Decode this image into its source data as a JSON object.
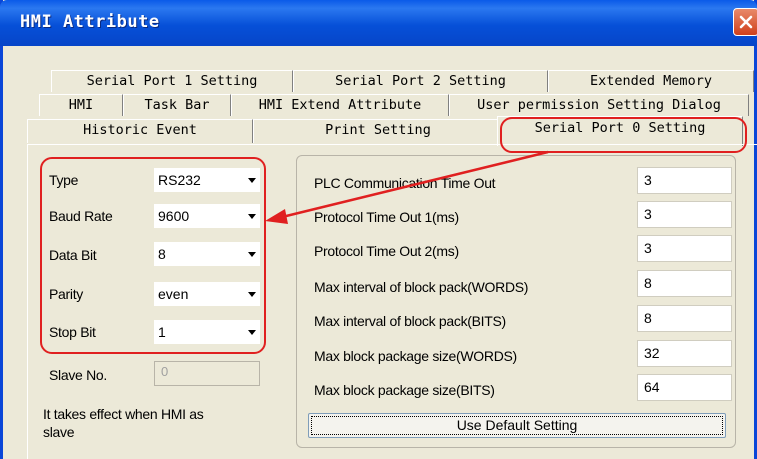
{
  "window": {
    "title": "HMI Attribute"
  },
  "tabs": {
    "row1": [
      "Serial Port 1 Setting",
      "Serial Port 2 Setting",
      "Extended Memory"
    ],
    "row2": [
      "HMI",
      "Task Bar",
      "HMI Extend Attribute",
      "User permission Setting Dialog"
    ],
    "row3": [
      "Historic Event",
      "Print Setting",
      "Serial Port 0 Setting"
    ],
    "active": "Serial Port 0 Setting"
  },
  "serial": {
    "type": {
      "label": "Type",
      "value": "RS232"
    },
    "baud_rate": {
      "label": "Baud Rate",
      "value": "9600"
    },
    "data_bit": {
      "label": "Data Bit",
      "value": "8"
    },
    "parity": {
      "label": "Parity",
      "value": "even"
    },
    "stop_bit": {
      "label": "Stop Bit",
      "value": "1"
    },
    "slave_no": {
      "label": "Slave No.",
      "value": "0"
    },
    "note_line1": "It takes effect when HMI as",
    "note_line2": "slave"
  },
  "timeouts": [
    {
      "label": "PLC Communication Time Out",
      "value": "3"
    },
    {
      "label": "Protocol Time Out 1(ms)",
      "value": "3"
    },
    {
      "label": "Protocol Time Out 2(ms)",
      "value": "3"
    },
    {
      "label": "Max interval of block pack(WORDS)",
      "value": "8"
    },
    {
      "label": "Max interval of block pack(BITS)",
      "value": "8"
    },
    {
      "label": "Max block package size(WORDS)",
      "value": "32"
    },
    {
      "label": "Max block package size(BITS)",
      "value": "64"
    }
  ],
  "default_button": "Use Default Setting",
  "colors": {
    "titlebar": "#0a5ae8",
    "annotation": "#e02020",
    "dialog_bg": "#ece9d8"
  }
}
